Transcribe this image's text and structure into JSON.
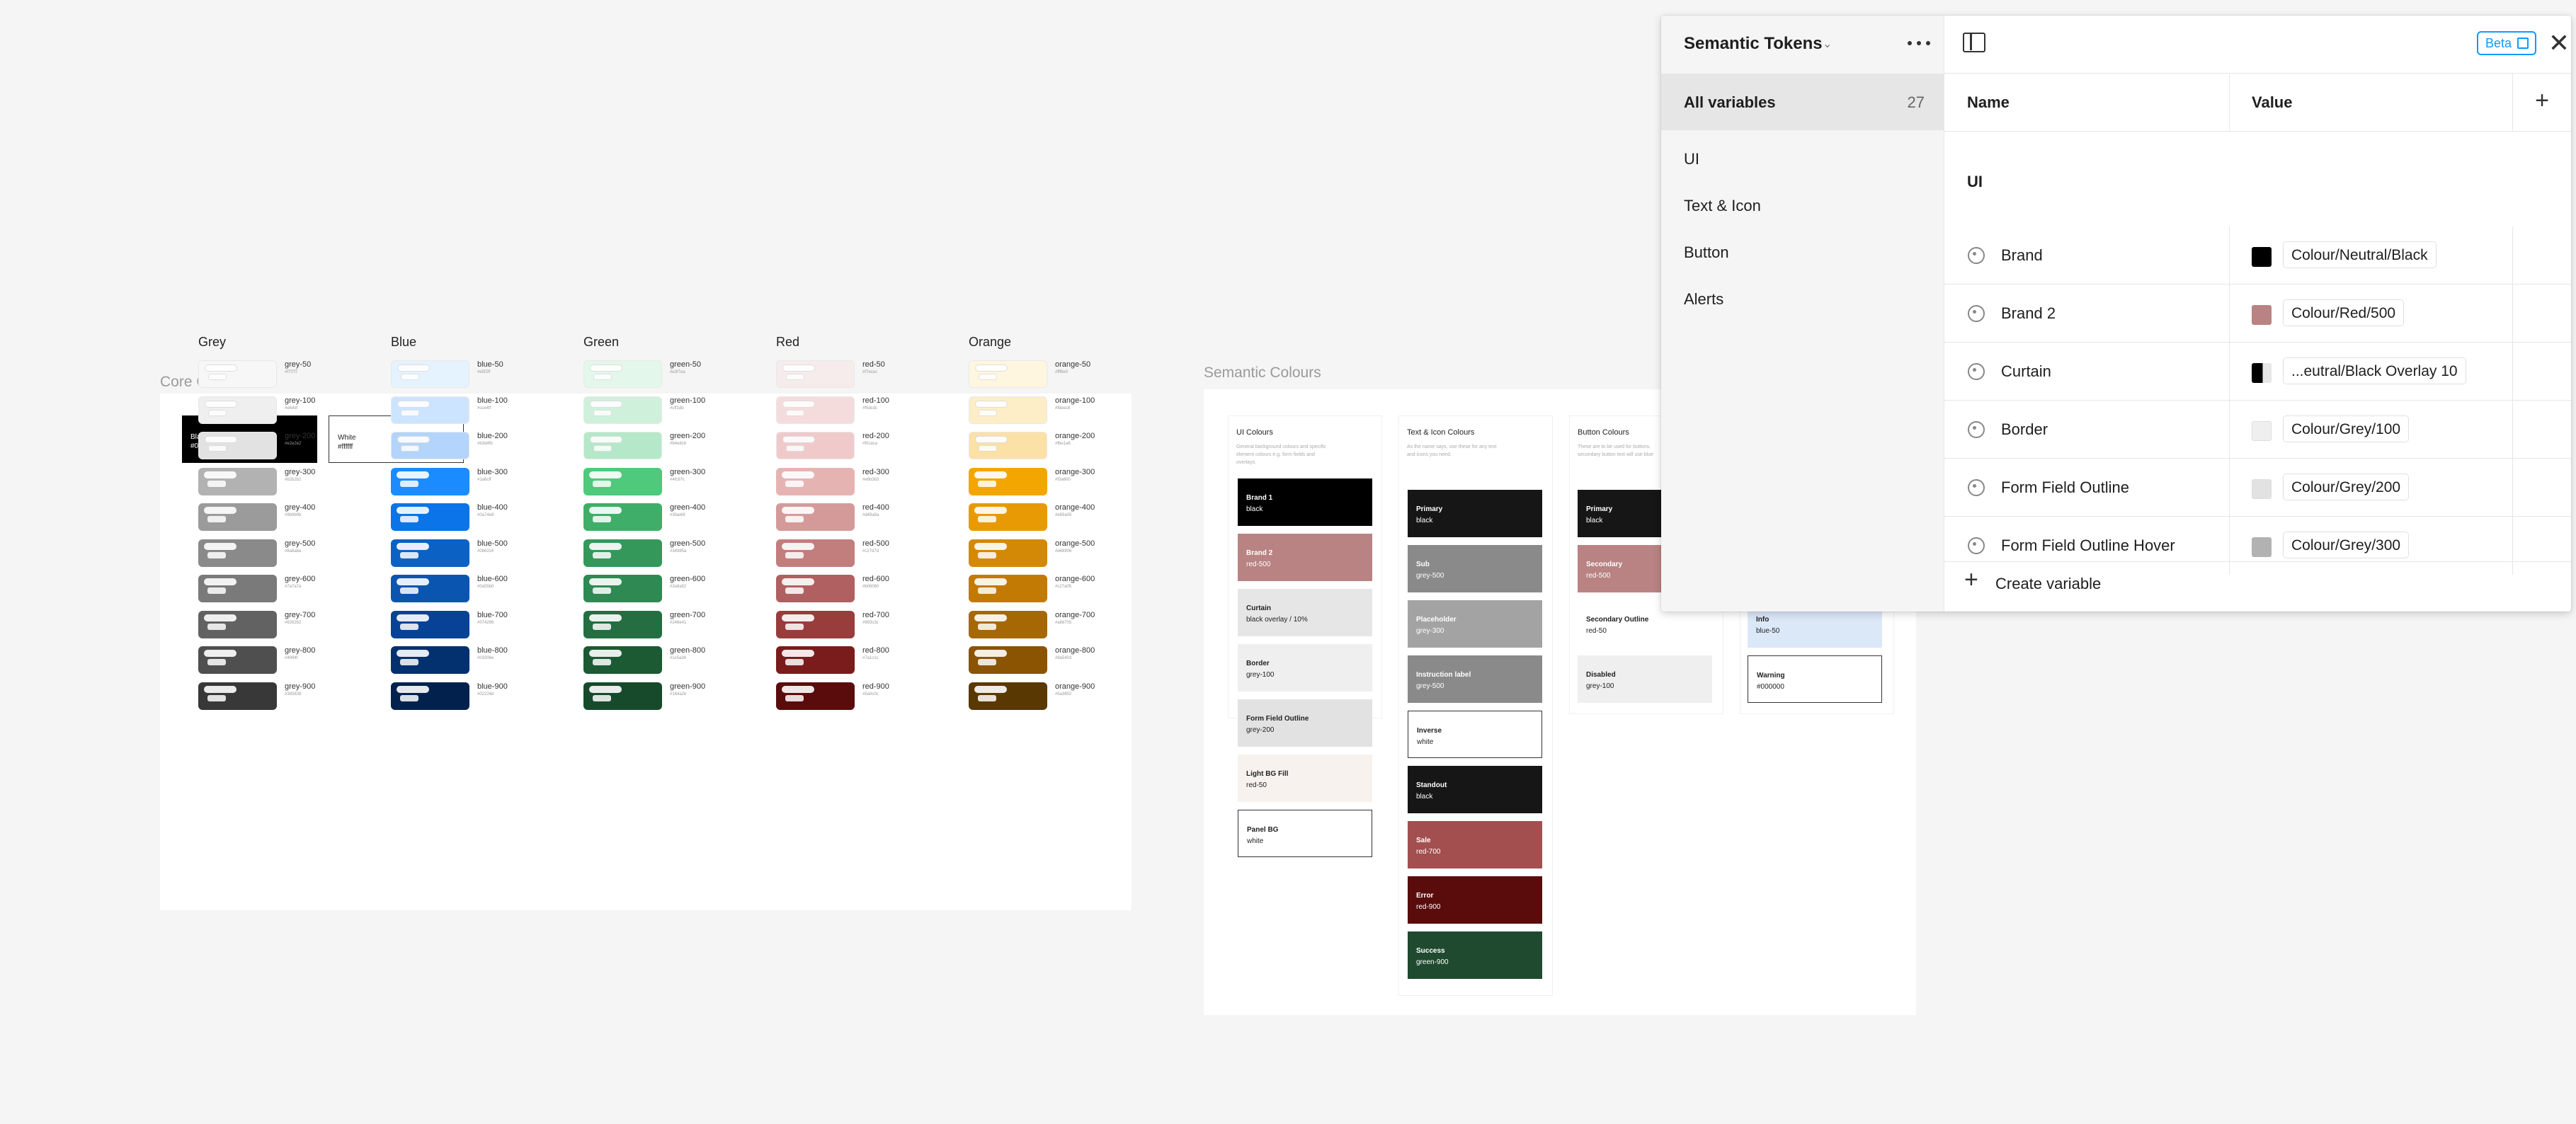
{
  "canvas": {
    "core_label": "Core Colours",
    "semantic_label": "Semantic Colours"
  },
  "core": {
    "black": {
      "name": "Black",
      "hex": "#000000"
    },
    "white": {
      "name": "White",
      "hex": "#ffffff"
    },
    "palettes": [
      {
        "title": "Grey",
        "prefix": "grey",
        "colors": [
          "#f7f7f7",
          "#efefef",
          "#e2e2e2",
          "#b2b2b2",
          "#9b9b9b",
          "#8a8a8a",
          "#7a7a7a",
          "#626262",
          "#4f4f4f",
          "#383838"
        ]
      },
      {
        "title": "Blue",
        "prefix": "blue",
        "colors": [
          "#e5f2ff",
          "#cce4ff",
          "#b3d4fb",
          "#1a8cff",
          "#0a74e8",
          "#0b62c4",
          "#0a55b0",
          "#074296",
          "#03306e",
          "#02224d"
        ]
      },
      {
        "title": "Green",
        "prefix": "green",
        "colors": [
          "#e3f7ea",
          "#cff1db",
          "#b4e8c8",
          "#4fc97c",
          "#3fae68",
          "#34985a",
          "#2e8a52",
          "#246e41",
          "#1c5a34",
          "#164a2b"
        ]
      },
      {
        "title": "Red",
        "prefix": "red",
        "colors": [
          "#f7ecec",
          "#f5dcdc",
          "#f0caca",
          "#e6b3b3",
          "#d49a9a",
          "#c27d7d",
          "#b06060",
          "#993c3c",
          "#7a1c1c",
          "#5a0c0c"
        ]
      },
      {
        "title": "Orange",
        "prefix": "orange",
        "colors": [
          "#fff6e0",
          "#fdeec8",
          "#fbe1a6",
          "#f3a600",
          "#e89a05",
          "#d48906",
          "#c27a05",
          "#a66705",
          "#8a5403",
          "#5a3802"
        ]
      }
    ],
    "steps": [
      "50",
      "100",
      "200",
      "300",
      "400",
      "500",
      "600",
      "700",
      "800",
      "900"
    ]
  },
  "semantic": {
    "columns": [
      {
        "title": "UI Colours",
        "desc": "General background colours and specific element colours e.g. form fields and overlays."
      },
      {
        "title": "Text & Icon Colours",
        "desc": "As the name says, use these for any text and icons you need."
      },
      {
        "title": "Button Colours",
        "desc": "These are to be used for buttons, secondary button text will use blue"
      },
      {
        "title": "",
        "desc": ""
      }
    ],
    "ui": [
      {
        "n": "Brand 1",
        "v": "black",
        "bg": "#000000",
        "fg": "#ffffff"
      },
      {
        "n": "Brand 2",
        "v": "red-500",
        "bg": "#b98383",
        "fg": "#ffffff"
      },
      {
        "n": "Curtain",
        "v": "black overlay / 10%",
        "bg": "#e6e6e6",
        "fg": "#222222"
      },
      {
        "n": "Border",
        "v": "grey-100",
        "bg": "#efefef",
        "fg": "#222222"
      },
      {
        "n": "Form Field Outline",
        "v": "grey-200",
        "bg": "#e2e2e2",
        "fg": "#222222"
      },
      {
        "n": "Light BG Fill",
        "v": "red-50",
        "bg": "#f7f2ee",
        "fg": "#222222"
      },
      {
        "n": "Panel BG",
        "v": "white",
        "bg": "#ffffff",
        "fg": "#222222",
        "border": true
      }
    ],
    "text": [
      {
        "n": "Primary",
        "v": "black",
        "bg": "#161616",
        "fg": "#ffffff"
      },
      {
        "n": "Sub",
        "v": "grey-500",
        "bg": "#8a8a8a",
        "fg": "#ffffff"
      },
      {
        "n": "Placeholder",
        "v": "grey-300",
        "bg": "#a3a3a3",
        "fg": "#ffffff"
      },
      {
        "n": "Instruction label",
        "v": "grey-500",
        "bg": "#8a8a8a",
        "fg": "#ffffff"
      },
      {
        "n": "Inverse",
        "v": "white",
        "bg": "#ffffff",
        "fg": "#222222",
        "border": true
      },
      {
        "n": "Standout",
        "v": "black",
        "bg": "#161616",
        "fg": "#ffffff"
      },
      {
        "n": "Sale",
        "v": "red-700",
        "bg": "#a34f4f",
        "fg": "#ffffff"
      },
      {
        "n": "Error",
        "v": "red-900",
        "bg": "#5a0c0c",
        "fg": "#ffffff"
      },
      {
        "n": "Success",
        "v": "green-900",
        "bg": "#1f4a2f",
        "fg": "#ffffff"
      }
    ],
    "button": [
      {
        "n": "Primary",
        "v": "black",
        "bg": "#161616",
        "fg": "#ffffff"
      },
      {
        "n": "Secondary",
        "v": "red-500",
        "bg": "#b98383",
        "fg": "#ffffff"
      },
      {
        "n": "Secondary Outline",
        "v": "red-50",
        "bg": "#ffffff",
        "fg": "#222222"
      },
      {
        "n": "Disabled",
        "v": "grey-100",
        "bg": "#efefef",
        "fg": "#222222"
      }
    ],
    "alerts": [
      {
        "n": "Info",
        "v": "blue-50",
        "bg": "#dbe8f7",
        "fg": "#222222"
      },
      {
        "n": "Warning",
        "v": "#000000",
        "bg": "#ffffff",
        "fg": "#222222",
        "border": true
      }
    ]
  },
  "panel": {
    "title": "Semantic Tokens",
    "all_label": "All variables",
    "all_count": "27",
    "collections": [
      "UI",
      "Text & Icon",
      "Button",
      "Alerts"
    ],
    "beta": "Beta",
    "col_name": "Name",
    "col_value": "Value",
    "group": "UI",
    "rows": [
      {
        "name": "Brand",
        "value": "Colour/Neutral/Black",
        "swatch": "#000000"
      },
      {
        "name": "Brand 2",
        "value": "Colour/Red/500",
        "swatch": "#b98383"
      },
      {
        "name": "Curtain",
        "value": "...eutral/Black Overlay 10",
        "swatch": "#000000"
      },
      {
        "name": "Border",
        "value": "Colour/Grey/100",
        "swatch": "#efefef"
      },
      {
        "name": "Form Field Outline",
        "value": "Colour/Grey/200",
        "swatch": "#e2e2e2"
      },
      {
        "name": "Form Field Outline Hover",
        "value": "Colour/Grey/300",
        "swatch": "#b2b2b2"
      }
    ],
    "create": "Create variable"
  }
}
